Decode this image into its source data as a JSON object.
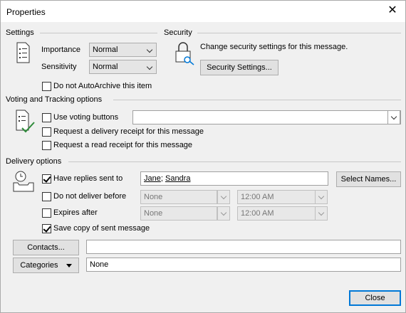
{
  "window": {
    "title": "Properties"
  },
  "settings": {
    "header": "Settings",
    "importance_label": "Importance",
    "importance_value": "Normal",
    "sensitivity_label": "Sensitivity",
    "sensitivity_value": "Normal",
    "autoarchive_label": "Do not AutoArchive this item",
    "autoarchive_checked": false
  },
  "security": {
    "header": "Security",
    "description": "Change security settings for this message.",
    "button_label": "Security Settings..."
  },
  "voting": {
    "header": "Voting and Tracking options",
    "use_voting_label": "Use voting buttons",
    "use_voting_value": "",
    "delivery_receipt_label": "Request a delivery receipt for this message",
    "read_receipt_label": "Request a read receipt for this message"
  },
  "delivery": {
    "header": "Delivery options",
    "replies_label": "Have replies sent to",
    "replies_checked": true,
    "replies_recipients": [
      "Jane",
      "Sandra"
    ],
    "replies_separator": ";",
    "select_names_label": "Select Names...",
    "do_not_deliver_label": "Do not deliver before",
    "do_not_deliver_date": "None",
    "do_not_deliver_time": "12:00 AM",
    "expires_label": "Expires after",
    "expires_date": "None",
    "expires_time": "12:00 AM",
    "save_copy_label": "Save copy of sent message",
    "save_copy_checked": true
  },
  "contacts": {
    "button_label": "Contacts...",
    "value": ""
  },
  "categories": {
    "button_label": "Categories",
    "value": "None"
  },
  "footer": {
    "close_label": "Close"
  }
}
